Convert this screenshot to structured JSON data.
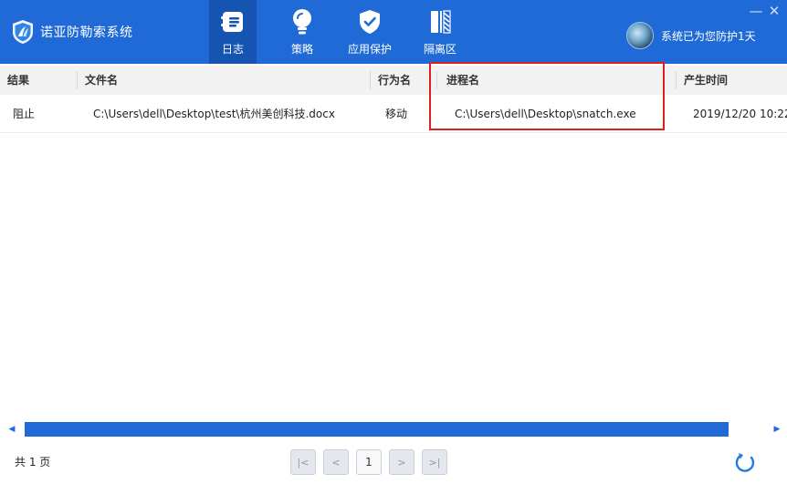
{
  "app": {
    "title": "诺亚防勒索系统",
    "status": "系统已为您防护1天",
    "window_controls": {
      "minimize": "—",
      "close": "✕"
    }
  },
  "nav": {
    "tabs": [
      {
        "label": "日志",
        "icon": "log-icon",
        "active": true
      },
      {
        "label": "策略",
        "icon": "lightbulb-icon",
        "active": false
      },
      {
        "label": "应用保护",
        "icon": "shield-check-icon",
        "active": false
      },
      {
        "label": "隔离区",
        "icon": "quarantine-icon",
        "active": false
      }
    ]
  },
  "table": {
    "columns": [
      "结果",
      "文件名",
      "行为名",
      "进程名",
      "产生时间"
    ],
    "rows": [
      {
        "result": "阻止",
        "filename": "C:\\Users\\dell\\Desktop\\test\\杭州美创科技.docx",
        "action": "移动",
        "process": "C:\\Users\\dell\\Desktop\\snatch.exe",
        "time": "2019/12/20 10:22"
      }
    ]
  },
  "footer": {
    "page_count": "共 1 页",
    "pager": {
      "first": "|<",
      "prev": "<",
      "current": "1",
      "next": ">",
      "last": ">|"
    }
  },
  "colors": {
    "header_bg": "#1f6ad6",
    "active_tab_bg": "#1554b0",
    "highlight_border": "#e0201d",
    "scrollbar": "#1f6ad6"
  }
}
